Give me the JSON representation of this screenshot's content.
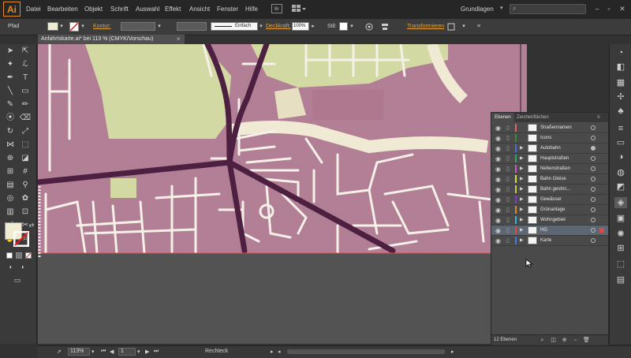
{
  "app": {
    "logo": "Ai",
    "bridge_badge": "Br",
    "workspace": "Grundlagen",
    "accent_color": "#e28b27"
  },
  "menu": [
    "Datei",
    "Bearbeiten",
    "Objekt",
    "Schrift",
    "Auswahl",
    "Effekt",
    "Ansicht",
    "Fenster",
    "Hilfe"
  ],
  "control": {
    "object_type": "Pfad",
    "stroke_label": "Kontur:",
    "stroke_profile": "Einfach",
    "opacity_label": "Deckkraft:",
    "opacity_value": "100%",
    "style_label": "Stil:",
    "transform_label": "Transformieren"
  },
  "document": {
    "tab_title": "Anfahrtskarte.ai* bei 113 % (CMYK/Vorschau)",
    "close_glyph": "×"
  },
  "layers_panel": {
    "tabs": [
      "Ebenen",
      "Zeichenflächen"
    ],
    "layers": [
      {
        "name": "Straßennamen",
        "color": "#e06767",
        "expandable": false,
        "selected": false,
        "has_art": false
      },
      {
        "name": "Icons",
        "color": "#3b8a3b",
        "expandable": false,
        "selected": false,
        "has_art": false
      },
      {
        "name": "Autobahn",
        "color": "#4a6de0",
        "expandable": true,
        "selected": false,
        "has_art": true
      },
      {
        "name": "Hauptstraßen",
        "color": "#2fa66f",
        "expandable": true,
        "selected": false,
        "has_art": false
      },
      {
        "name": "Nebenstraßen",
        "color": "#c85bc8",
        "expandable": true,
        "selected": false,
        "has_art": false
      },
      {
        "name": "Bahn Gleise",
        "color": "#d9d94a",
        "expandable": true,
        "selected": false,
        "has_art": false
      },
      {
        "name": "Bahn gestric...",
        "color": "#c8c84a",
        "expandable": true,
        "selected": false,
        "has_art": false
      },
      {
        "name": "Gewässer",
        "color": "#7a3bc8",
        "expandable": true,
        "selected": false,
        "has_art": false
      },
      {
        "name": "Grünanlage",
        "color": "#d98a2f",
        "expandable": true,
        "selected": false,
        "has_art": false
      },
      {
        "name": "Wohngebiet",
        "color": "#3bb3d9",
        "expandable": true,
        "selected": false,
        "has_art": false
      },
      {
        "name": "HG",
        "color": "#d94a4a",
        "expandable": true,
        "selected": true,
        "has_art": false
      },
      {
        "name": "Karte",
        "color": "#4a7ad9",
        "expandable": true,
        "selected": false,
        "has_art": false
      }
    ],
    "count_label": "12 Ebenen"
  },
  "status": {
    "zoom": "113%",
    "page": "1",
    "tool": "Rechteck"
  },
  "colors": {
    "map_pink": "#b0788f",
    "map_green": "#d3d9a3",
    "road_dark": "#4d1f40",
    "road_light": "#f3eee4",
    "panel_bg": "#4a4a4a",
    "selected_row": "#5d6774"
  }
}
